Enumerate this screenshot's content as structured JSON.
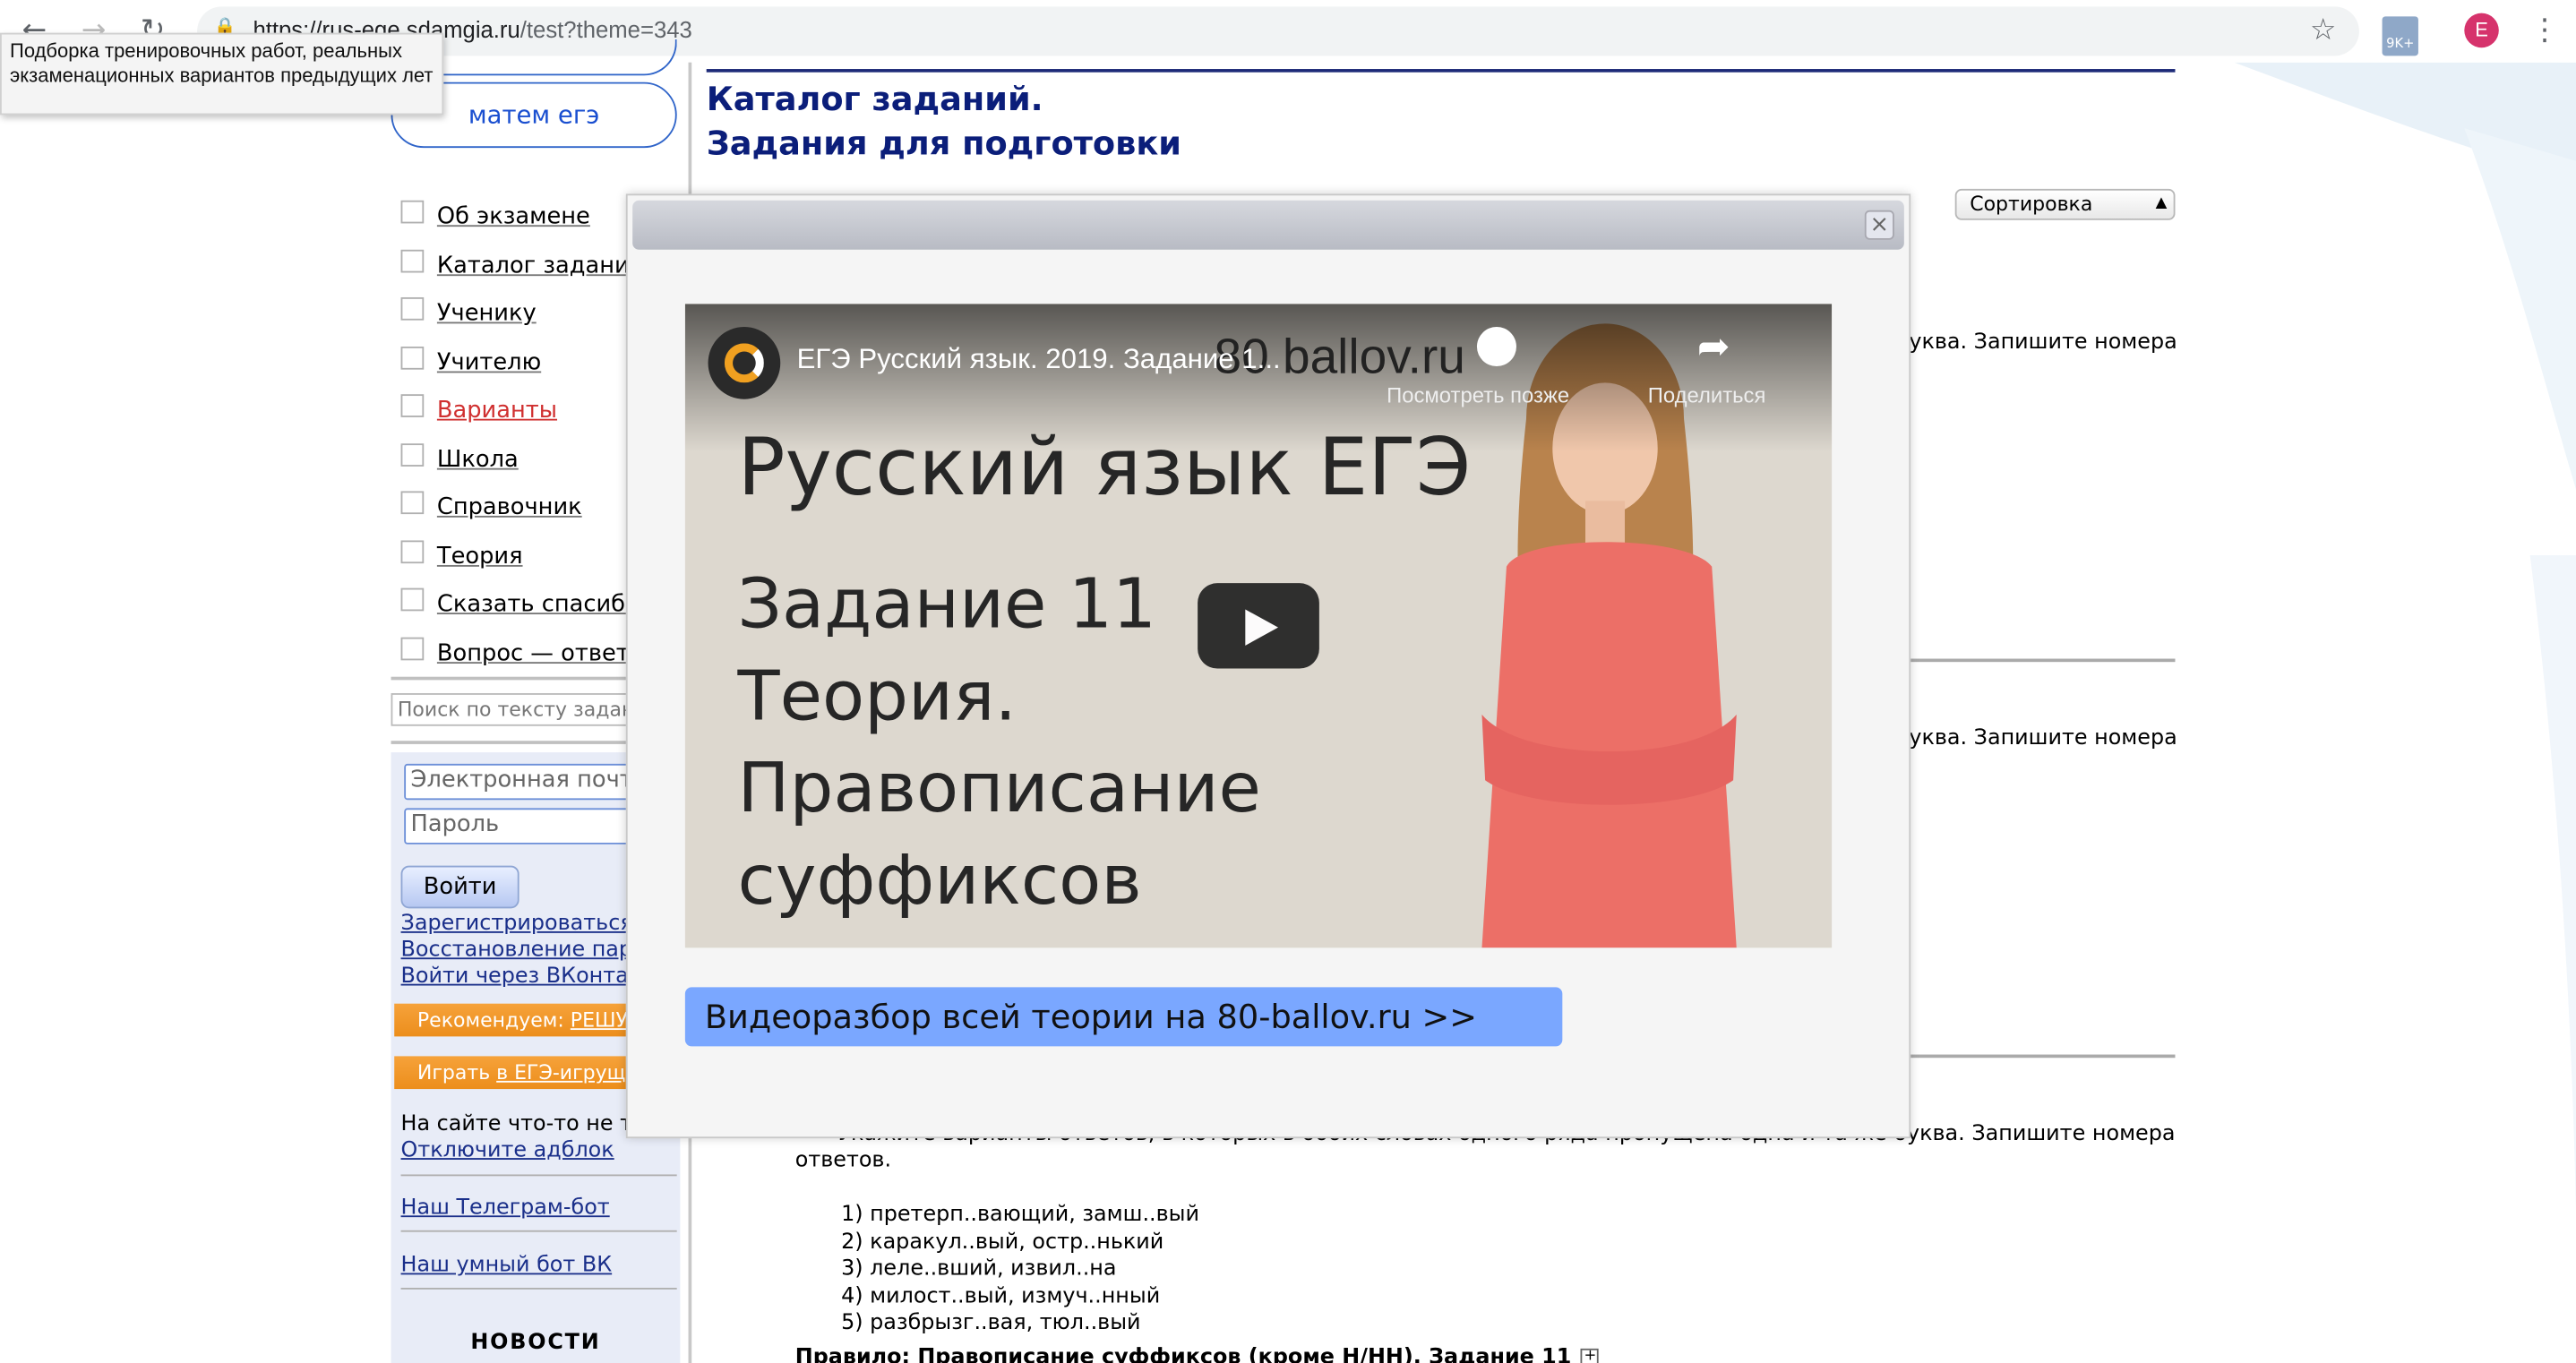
{
  "browser": {
    "url_host": "https://rus-ege.sdamgia.ru",
    "url_path": "/test?theme=343",
    "extension_badge": "9K+",
    "profile_initial": "E"
  },
  "tooltip": "Подборка тренировочных работ, реальных экзаменационных вариантов предыдущих лет",
  "sidebar": {
    "pill_label": "матем егэ",
    "menu": [
      {
        "label": "Об экзамене"
      },
      {
        "label": "Каталог заданий"
      },
      {
        "label": "Ученику"
      },
      {
        "label": "Учителю"
      },
      {
        "label": "Варианты"
      },
      {
        "label": "Школа"
      },
      {
        "label": "Справочник"
      },
      {
        "label": "Теория"
      },
      {
        "label": "Сказать спасибо"
      },
      {
        "label": "Вопрос — ответ"
      }
    ],
    "search_placeholder": "Поиск по тексту задани",
    "email_placeholder": "Электронная почта",
    "password_placeholder": "Пароль",
    "login_button": "Войти",
    "register_link": "Зарегистрироваться",
    "restore_link": "Восстановление парол",
    "vk_link": "Войти через ВКонтакт",
    "recommend_prefix": "Рекомендуем: ",
    "recommend_link": "РЕШУ",
    "play_prefix": "Играть ",
    "play_link": "в ЕГЭ-игрущ",
    "adblock_text": "На сайте что-то не та",
    "adblock_link": "Отключите адблок",
    "telegram_link": "Наш Телеграм-бот",
    "vk_bot_link": "Наш умный бот ВК",
    "news_heading": "НОВОСТИ"
  },
  "main": {
    "title_line1": "Каталог заданий.",
    "title_line2": "Задания для подготовки",
    "sort_label": "Сортировка",
    "frag_text": "уква. Запишите номера",
    "task_text": "Укажите варианты ответов, в которых в обоих словах одного ряда пропущена одна и та же буква. Запишите номера ответов.",
    "options": [
      "1) претерп..вающий, замш..вый",
      "2) каракул..вый, остр..нький",
      "3) леле..вший, извил..на",
      "4) милост..вый, измуч..нный",
      "5) разбрызг..вая, тюл..вый"
    ],
    "rule_link": "Правило: Правописание суффиксов (кроме Н/НН). Задание 11"
  },
  "modal": {
    "close_label": "×",
    "video": {
      "title": "ЕГЭ Русский язык. 2019. Задание 1...",
      "brand": "80 ballov.ru",
      "watch_later": "Посмотреть позже",
      "share": "Поделиться",
      "heading": "Русский язык ЕГЭ",
      "line1": "Задание 11",
      "line2": "Теория.",
      "line3": "Правописание",
      "line4": "суффиксов"
    },
    "cta": "Видеоразбор всей теории на 80-ballov.ru >>"
  }
}
